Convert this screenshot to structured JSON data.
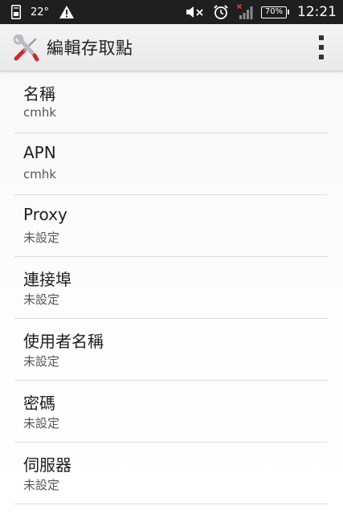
{
  "status_bar": {
    "left_icons": [
      "sim-card-icon",
      "warning-icon"
    ],
    "temperature": "22°",
    "right_icons": [
      "mute-icon",
      "alarm-clock-icon",
      "no-signal-icon",
      "battery-icon"
    ],
    "battery": "70%",
    "time": "12:21"
  },
  "action_bar": {
    "app_icon": "tools-icon",
    "title": "編輯存取點",
    "overflow_icon": "overflow-menu-icon"
  },
  "preferences": [
    {
      "title": "名稱",
      "summary": "cmhk"
    },
    {
      "title": "APN",
      "summary": "cmhk"
    },
    {
      "title": "Proxy",
      "summary": "未設定"
    },
    {
      "title": "連接埠",
      "summary": "未設定"
    },
    {
      "title": "使用者名稱",
      "summary": "未設定"
    },
    {
      "title": "密碼",
      "summary": "未設定"
    },
    {
      "title": "伺服器",
      "summary": "未設定"
    }
  ]
}
